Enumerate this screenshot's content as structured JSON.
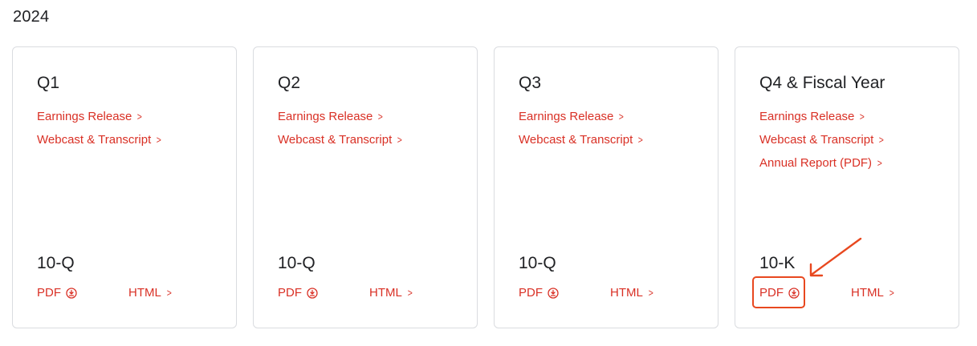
{
  "year": "2024",
  "colors": {
    "link": "#d93025",
    "annotation": "#e8481f",
    "border": "#dadce0"
  },
  "cards": [
    {
      "title": "Q1",
      "links": [
        "Earnings Release",
        "Webcast & Transcript"
      ],
      "filing": "10-Q",
      "pdf_label": "PDF",
      "html_label": "HTML"
    },
    {
      "title": "Q2",
      "links": [
        "Earnings Release",
        "Webcast & Transcript"
      ],
      "filing": "10-Q",
      "pdf_label": "PDF",
      "html_label": "HTML"
    },
    {
      "title": "Q3",
      "links": [
        "Earnings Release",
        "Webcast & Transcript"
      ],
      "filing": "10-Q",
      "pdf_label": "PDF",
      "html_label": "HTML"
    },
    {
      "title": "Q4 & Fiscal Year",
      "links": [
        "Earnings Release",
        "Webcast & Transcript",
        "Annual Report (PDF)"
      ],
      "filing": "10-K",
      "pdf_label": "PDF",
      "html_label": "HTML"
    }
  ],
  "icons": {
    "chevron": "chevron-right-icon",
    "download": "download-circle-icon",
    "annotation_arrow": "arrow-annotation-icon"
  },
  "chevron_glyph": ">"
}
